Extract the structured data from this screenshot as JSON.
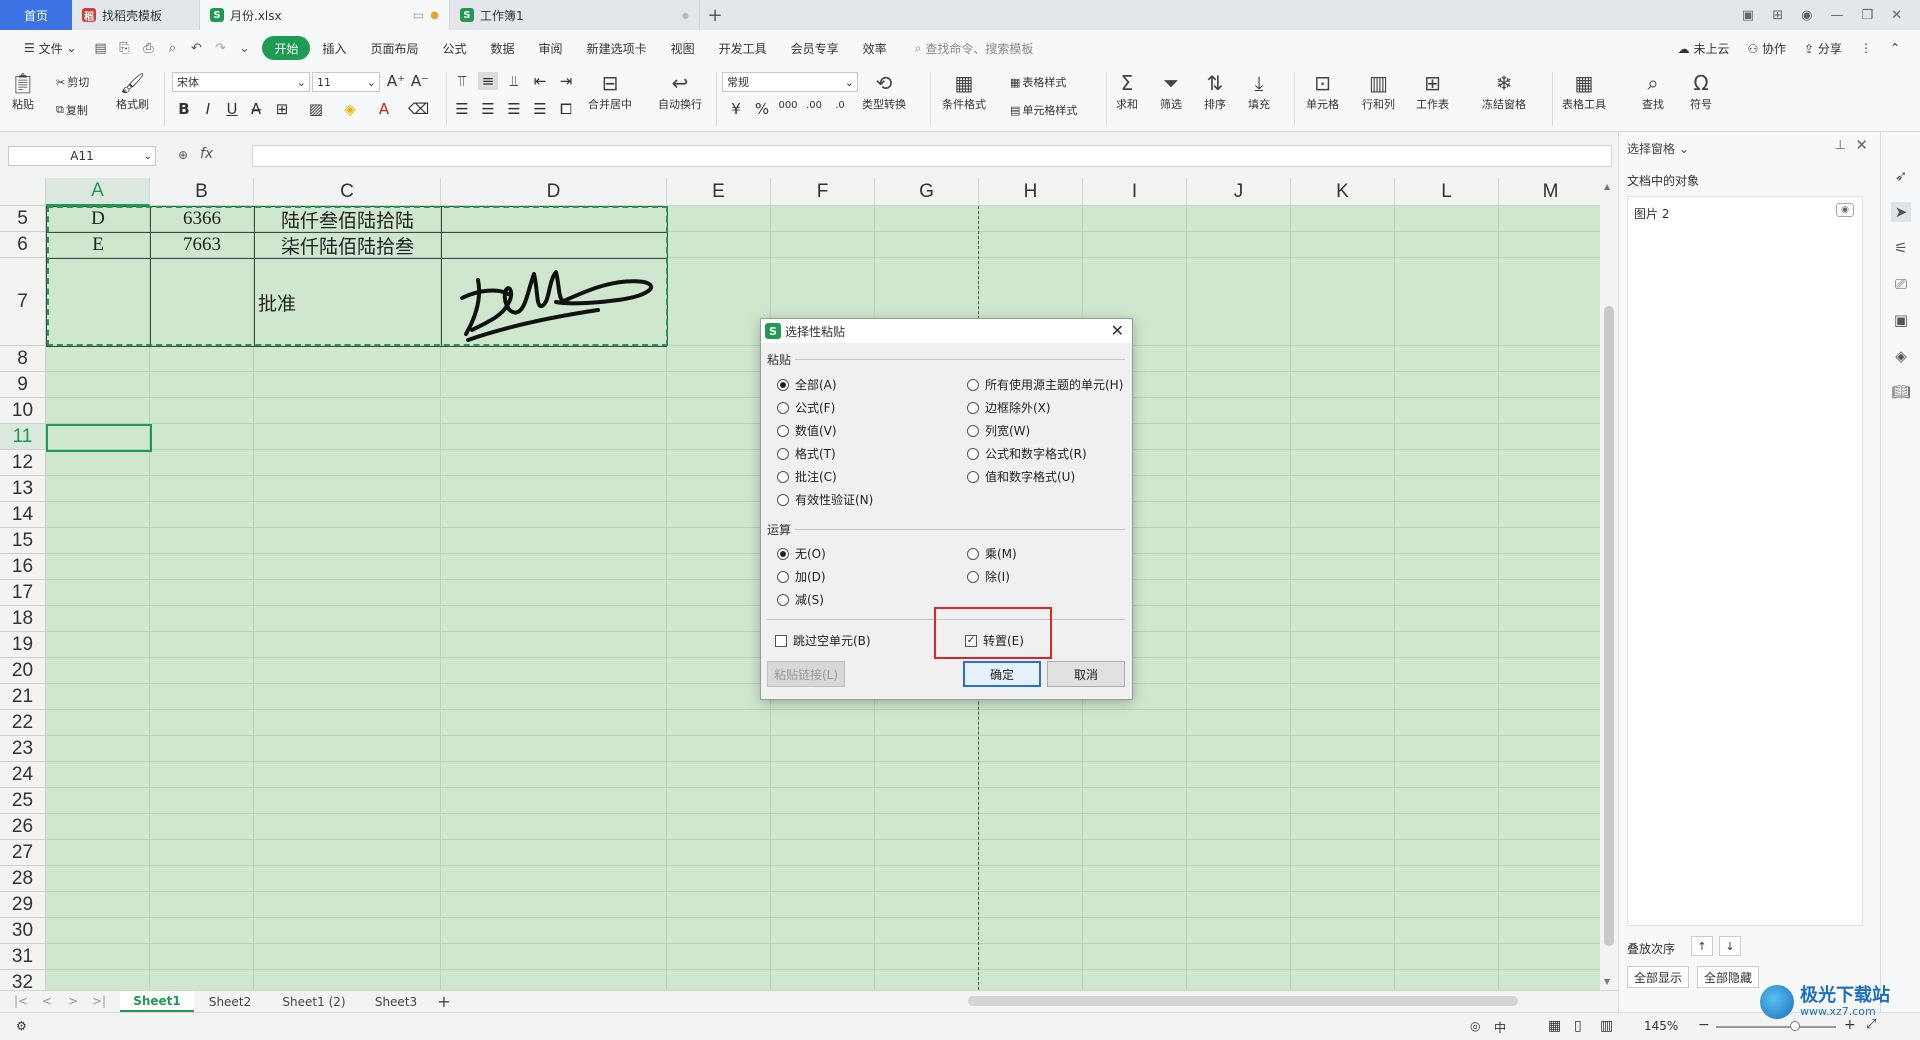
{
  "tabs": {
    "home": "首页",
    "items": [
      {
        "label": "找稻壳模板",
        "logo": "稻",
        "logo_color": "#d33a3a"
      },
      {
        "label": "月份.xlsx",
        "logo": "S",
        "logo_color": "#1e9a53"
      },
      {
        "label": "工作簿1",
        "logo": "S",
        "logo_color": "#1e9a53"
      }
    ],
    "plus": "+"
  },
  "menu": {
    "file": "文件",
    "items": [
      "开始",
      "插入",
      "页面布局",
      "公式",
      "数据",
      "审阅",
      "新建选项卡",
      "视图",
      "开发工具",
      "会员专享",
      "效率"
    ],
    "search": "查找命令、搜索模板",
    "right": [
      "未上云",
      "协作",
      "分享"
    ]
  },
  "ribbon": {
    "paste": "粘贴",
    "cut": "剪切",
    "copy": "复制",
    "format_painter": "格式刷",
    "font_name": "宋体",
    "font_size": "11",
    "number_format": "常规",
    "merge_center": "合并居中",
    "wrap_text": "自动换行",
    "type_convert": "类型转换",
    "cond_format": "条件格式",
    "table_style": "表格样式",
    "cell_style": "单元格样式",
    "sum": "求和",
    "filter": "筛选",
    "sort": "排序",
    "fill": "填充",
    "cell": "单元格",
    "row_col": "行和列",
    "worksheet": "工作表",
    "freeze": "冻结窗格",
    "table_tools": "表格工具",
    "find": "查找",
    "symbol": "符号"
  },
  "formula_bar": {
    "name_box": "A11",
    "fx": "fx",
    "value": ""
  },
  "grid": {
    "columns": [
      "A",
      "B",
      "C",
      "D",
      "E",
      "F",
      "G",
      "H",
      "I",
      "J",
      "K",
      "L",
      "M"
    ],
    "rows": [
      "5",
      "6",
      "7",
      "8",
      "9",
      "10",
      "11",
      "12",
      "13",
      "14",
      "15",
      "16",
      "17",
      "18",
      "19",
      "20",
      "21",
      "22",
      "23",
      "24",
      "25",
      "26",
      "27",
      "28",
      "29",
      "30",
      "31",
      "32"
    ],
    "selected_column": "A",
    "selected_row": "11",
    "cells": {
      "a5": "D",
      "b5": "6366",
      "c5": "陆仟叁佰陆拾陆",
      "a6": "E",
      "b6": "7663",
      "c6": "柒仟陆佰陆拾叁",
      "c7": "批准"
    }
  },
  "sheets": {
    "tabs": [
      "Sheet1",
      "Sheet2",
      "Sheet1 (2)",
      "Sheet3"
    ],
    "active": "Sheet1",
    "add": "+"
  },
  "status": {
    "zoom": "145%",
    "input_mode": "中"
  },
  "right_pane": {
    "title": "选择窗格",
    "subtitle": "文档中的对象",
    "item": "图片 2",
    "stack_order": "叠放次序",
    "show_all": "全部显示",
    "hide_all": "全部隐藏"
  },
  "dialog": {
    "title": "选择性粘贴",
    "paste_group": "粘贴",
    "paste_left": [
      "全部(A)",
      "公式(F)",
      "数值(V)",
      "格式(T)",
      "批注(C)",
      "有效性验证(N)"
    ],
    "paste_right": [
      "所有使用源主题的单元(H)",
      "边框除外(X)",
      "列宽(W)",
      "公式和数字格式(R)",
      "值和数字格式(U)"
    ],
    "operation_group": "运算",
    "op_left": [
      "无(O)",
      "加(D)",
      "减(S)"
    ],
    "op_right": [
      "乘(M)",
      "除(I)"
    ],
    "skip_blanks": "跳过空单元(B)",
    "transpose": "转置(E)",
    "paste_link": "粘贴链接(L)",
    "ok": "确定",
    "cancel": "取消",
    "highlight_color": "#e0242b"
  },
  "watermark": {
    "main": "极光下载站",
    "url": "www.xz7.com"
  }
}
